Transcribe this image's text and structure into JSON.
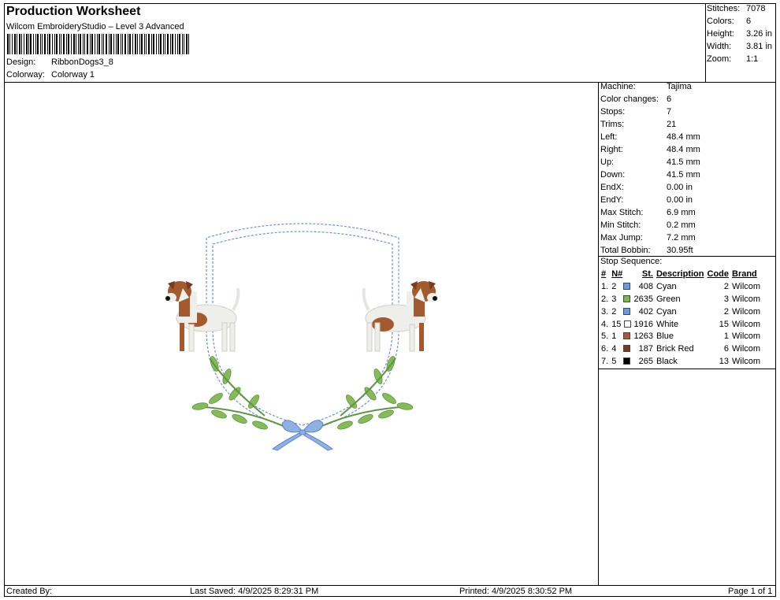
{
  "header": {
    "title": "Production Worksheet",
    "software": "Wilcom EmbroideryStudio – Level 3 Advanced",
    "design_label": "Design:",
    "design_value": "RibbonDogs3_8",
    "colorway_label": "Colorway:",
    "colorway_value": "Colorway 1"
  },
  "summary": [
    {
      "label": "Stitches:",
      "value": "7078"
    },
    {
      "label": "Colors:",
      "value": "6"
    },
    {
      "label": "Height:",
      "value": "3.26 in"
    },
    {
      "label": "Width:",
      "value": "3.81 in"
    },
    {
      "label": "Zoom:",
      "value": "1:1"
    }
  ],
  "specs": [
    {
      "label": "Machine:",
      "value": "Tajima"
    },
    {
      "label": "Color changes:",
      "value": "6"
    },
    {
      "label": "Stops:",
      "value": "7"
    },
    {
      "label": "Trims:",
      "value": "21"
    },
    {
      "label": "Left:",
      "value": "48.4 mm"
    },
    {
      "label": "Right:",
      "value": "48.4 mm"
    },
    {
      "label": "Up:",
      "value": "41.5 mm"
    },
    {
      "label": "Down:",
      "value": "41.5 mm"
    },
    {
      "label": "EndX:",
      "value": "0.00 in"
    },
    {
      "label": "EndY:",
      "value": "0.00 in"
    },
    {
      "label": "Max Stitch:",
      "value": "6.9 mm"
    },
    {
      "label": "Min Stitch:",
      "value": "0.2 mm"
    },
    {
      "label": "Max Jump:",
      "value": "7.2 mm"
    },
    {
      "label": "Total Bobbin:",
      "value": "30.95ft"
    }
  ],
  "stop_sequence": {
    "title": "Stop Sequence:",
    "columns": [
      "#",
      "N#",
      "St.",
      "Description",
      "Code",
      "Brand"
    ],
    "rows": [
      {
        "num": "1.",
        "n": "2",
        "color": "#6f9ad8",
        "st": "408",
        "desc": "Cyan",
        "code": "2",
        "brand": "Wilcom"
      },
      {
        "num": "2.",
        "n": "3",
        "color": "#7fb45a",
        "st": "2635",
        "desc": "Green",
        "code": "3",
        "brand": "Wilcom"
      },
      {
        "num": "3.",
        "n": "2",
        "color": "#6f9ad8",
        "st": "402",
        "desc": "Cyan",
        "code": "2",
        "brand": "Wilcom"
      },
      {
        "num": "4.",
        "n": "15",
        "color": "#ffffff",
        "st": "1916",
        "desc": "White",
        "code": "15",
        "brand": "Wilcom"
      },
      {
        "num": "5.",
        "n": "1",
        "color": "#a85a35",
        "st": "1263",
        "desc": "Blue",
        "code": "1",
        "brand": "Wilcom"
      },
      {
        "num": "6.",
        "n": "4",
        "color": "#7a3b22",
        "st": "187",
        "desc": "Brick Red",
        "code": "6",
        "brand": "Wilcom"
      },
      {
        "num": "7.",
        "n": "5",
        "color": "#000000",
        "st": "265",
        "desc": "Black",
        "code": "13",
        "brand": "Wilcom"
      }
    ]
  },
  "footer": {
    "created_by": "Created By:",
    "last_saved": "Last Saved: 4/9/2025 8:29:31 PM",
    "printed": "Printed: 4/9/2025 8:30:52 PM",
    "page": "Page 1 of 1"
  }
}
